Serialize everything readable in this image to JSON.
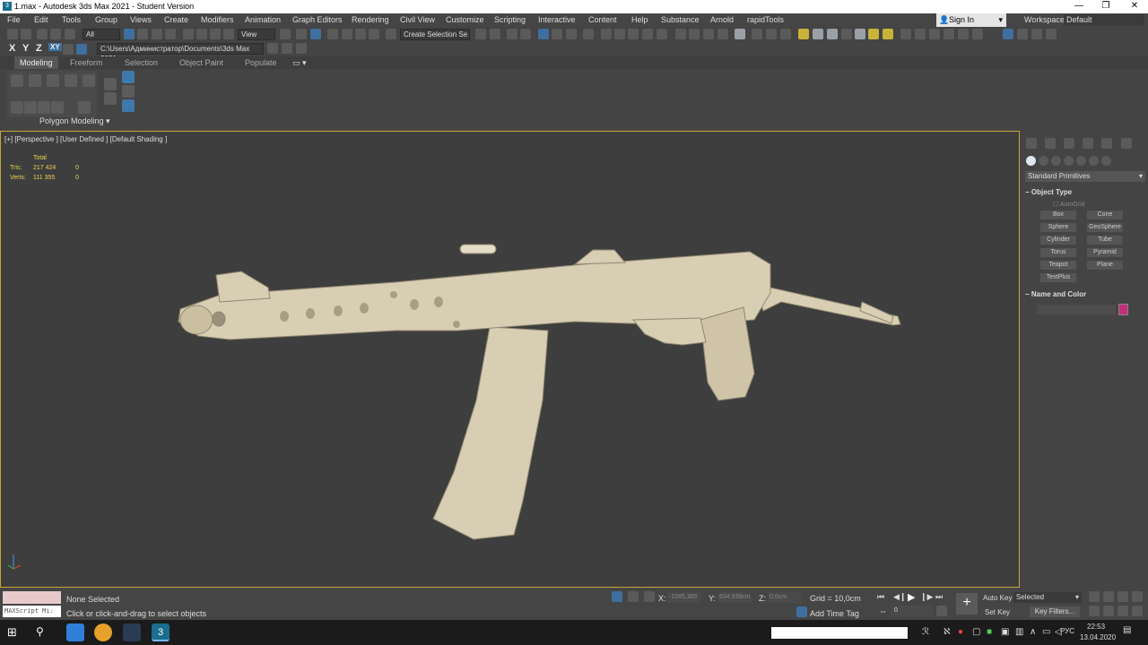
{
  "window": {
    "title": "1.max - Autodesk 3ds Max 2021 - Student Version",
    "minimize": "—",
    "maximize": "❐",
    "close": "✕"
  },
  "menu": [
    "File",
    "Edit",
    "Tools",
    "Group",
    "Views",
    "Create",
    "Modifiers",
    "Animation",
    "Graph Editors",
    "Rendering",
    "Civil View",
    "Customize",
    "Scripting",
    "Interactive",
    "Content",
    "Help",
    "Substance",
    "Arnold",
    "rapidTools"
  ],
  "signin": {
    "label": "Sign In"
  },
  "workspaces": {
    "label": "Workspaces:",
    "value": "Default"
  },
  "toolbar": {
    "selection_filter": "All",
    "ref_coord": "View",
    "selection_set": "Create Selection Se",
    "axes": [
      "X",
      "Y",
      "Z",
      "XY"
    ],
    "project_path": "C:\\Users\\Администратор\\Documents\\3ds Max 2021"
  },
  "ribbon": {
    "tabs": [
      "Modeling",
      "Freeform",
      "Selection",
      "Object Paint",
      "Populate"
    ],
    "active_tab": "Modeling",
    "panel_label": "Polygon Modeling ▾"
  },
  "viewport": {
    "label": "[+] [Perspective ] [User Defined ] [Default Shading ]",
    "stats": {
      "header": "Total",
      "tris_label": "Tris:",
      "tris_value": "217 424",
      "tris_sel": "0",
      "verts_label": "Verts:",
      "verts_value": "111 355",
      "verts_sel": "0"
    }
  },
  "command_panel": {
    "category": "Standard Primitives",
    "object_type_title": "Object Type",
    "autogrid": "AutoGrid",
    "buttons": [
      "Box",
      "Cone",
      "Sphere",
      "GeoSphere",
      "Cylinder",
      "Tube",
      "Torus",
      "Pyramid",
      "Teapot",
      "Plane",
      "TextPlus"
    ],
    "name_color_title": "Name and Color",
    "color": "#c2307a"
  },
  "status": {
    "none_selected": "None Selected",
    "prompt": "Click or click-and-drag to select objects",
    "maxscript": "MAXScript Mi:",
    "x_label": "X:",
    "x_value": "-1585,365",
    "y_label": "Y:",
    "y_value": "634,939cm",
    "z_label": "Z:",
    "z_value": "0,0cm",
    "grid": "Grid = 10,0cm",
    "add_time_tag": "Add Time Tag",
    "frame": "0",
    "auto_key": "Auto Key",
    "set_key": "Set Key",
    "selected": "Selected",
    "key_filters": "Key Filters..."
  },
  "taskbar": {
    "lang": "РУС",
    "time": "22:53",
    "date": "13.04.2020"
  }
}
